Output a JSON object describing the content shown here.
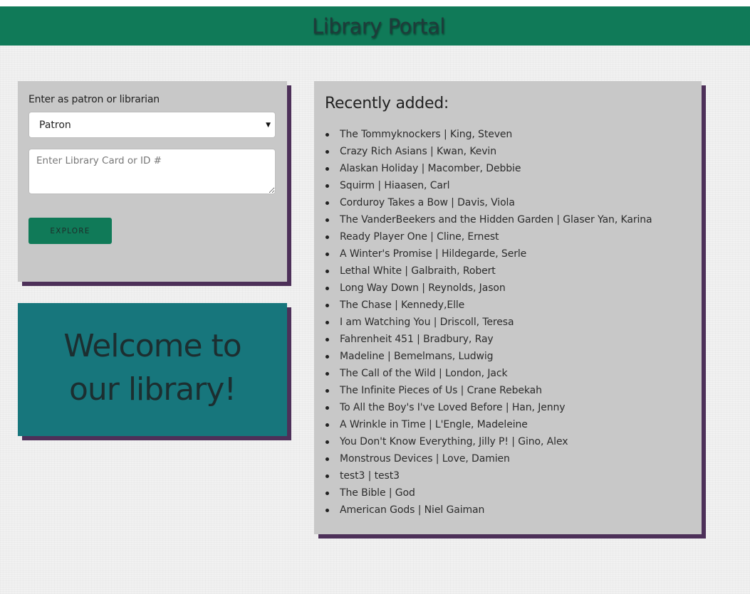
{
  "header": {
    "title": "Library Portal"
  },
  "login": {
    "label": "Enter as patron or librarian",
    "role_selected": "Patron",
    "card_placeholder": "Enter Library Card or ID #",
    "explore_label": "EXPLORE"
  },
  "welcome": {
    "line1": "Welcome to",
    "line2": "our library!"
  },
  "recent": {
    "heading": "Recently added:",
    "books": [
      "The Tommyknockers | King, Steven",
      "Crazy Rich Asians | Kwan, Kevin",
      "Alaskan Holiday | Macomber, Debbie",
      "Squirm | Hiaasen, Carl",
      "Corduroy Takes a Bow | Davis, Viola",
      "The VanderBeekers and the Hidden Garden | Glaser Yan, Karina",
      "Ready Player One | Cline, Ernest",
      "A Winter's Promise | Hildegarde, Serle",
      "Lethal White | Galbraith, Robert",
      "Long Way Down | Reynolds, Jason",
      "The Chase | Kennedy,Elle",
      "I am Watching You | Driscoll, Teresa",
      "Fahrenheit 451 | Bradbury, Ray",
      "Madeline | Bemelmans, Ludwig",
      "The Call of the Wild | London, Jack",
      "The Infinite Pieces of Us | Crane Rebekah",
      "To All the Boy's I've Loved Before | Han, Jenny",
      "A Wrinkle in Time | L'Engle, Madeleine",
      "You Don't Know Everything, Jilly P! | Gino, Alex",
      "Monstrous Devices | Love, Damien",
      "test3 | test3",
      "The Bible | God",
      "American Gods | Niel Gaiman"
    ]
  },
  "colors": {
    "header_bg": "#107a58",
    "panel_bg": "#c8c8c8",
    "panel_shadow": "#4d3059",
    "welcome_bg": "#17767c",
    "button_bg": "#107a58"
  }
}
